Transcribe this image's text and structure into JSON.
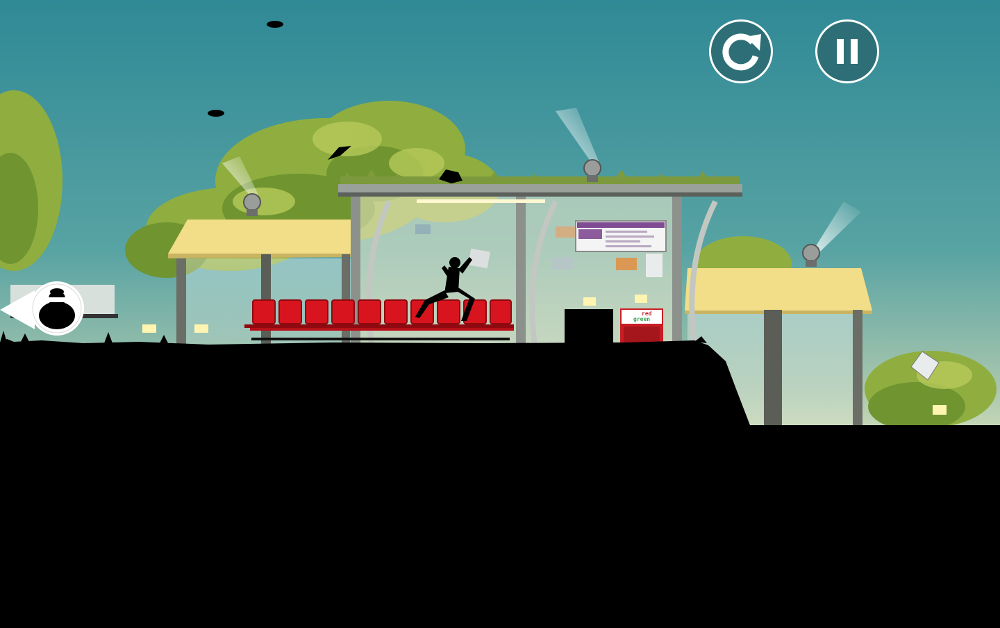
{
  "hud": {
    "restart_icon": "restart-icon",
    "pause_icon": "pause-icon",
    "chaser_indicator_icon": "hunter-silhouette-icon",
    "button_fill": "#2e6f77",
    "button_ring": "#ffffff"
  },
  "vending_machine": {
    "label_top": "red",
    "label_bottom": "green"
  },
  "scene": {
    "sky_top": "#2f8996",
    "sky_bottom": "#e4e8bf",
    "seat_color": "#d8141e",
    "roof_color": "#f2de88",
    "silhouette": "#000000"
  }
}
